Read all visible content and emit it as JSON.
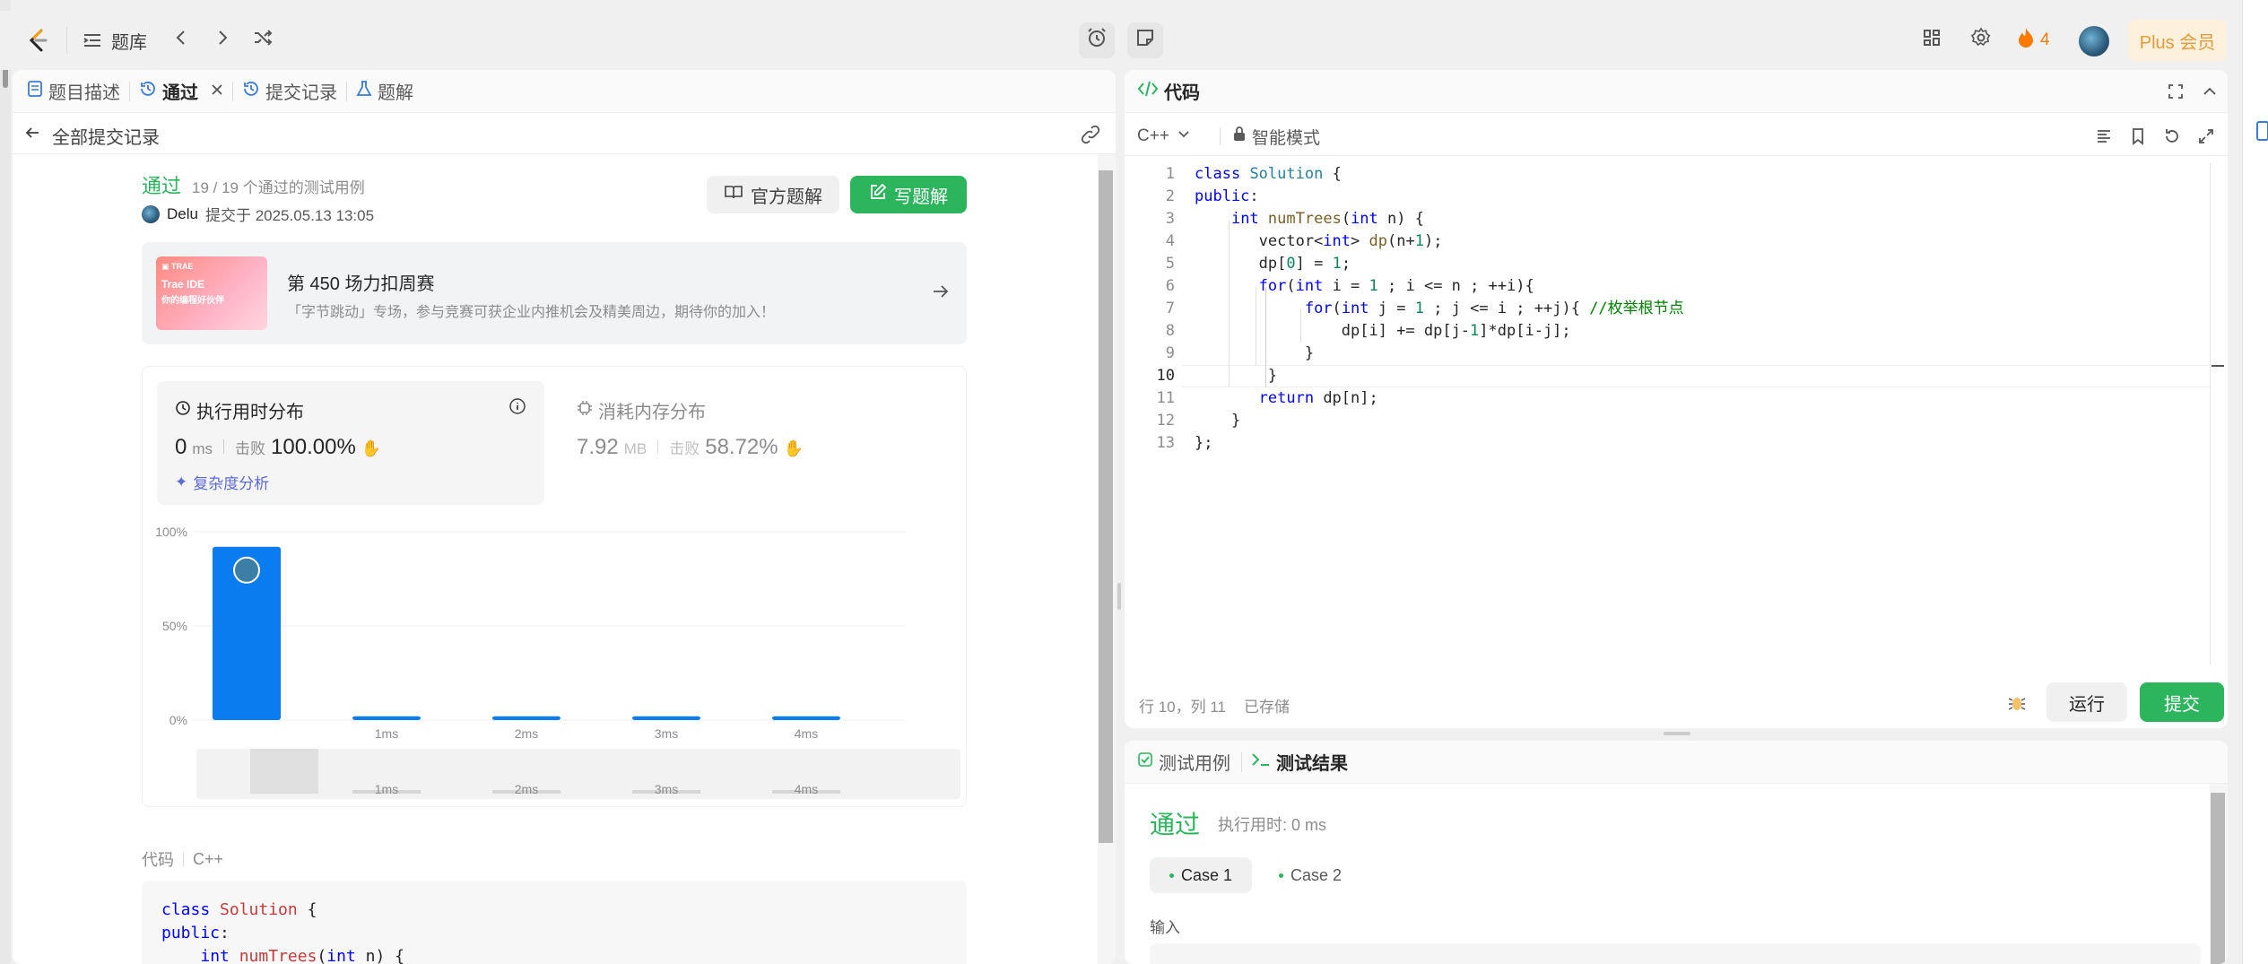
{
  "topbar": {
    "problem_bank": "题库",
    "streak": "4",
    "plus_label": "Plus 会员"
  },
  "left_tabs": [
    {
      "label": "题目描述",
      "icon": "description-icon"
    },
    {
      "label": "通过",
      "icon": "history-icon"
    },
    {
      "label": "提交记录",
      "icon": "history-icon"
    },
    {
      "label": "题解",
      "icon": "flask-icon"
    }
  ],
  "breadcrumb": {
    "back_label": "全部提交记录"
  },
  "submission": {
    "status": "通过",
    "testcases": "19 / 19 个通过的测试用例",
    "user": "Delu",
    "submitted_at": "提交于 2025.05.13 13:05",
    "official_solution": "官方题解",
    "write_solution": "写题解"
  },
  "banner": {
    "image_text_1": "Trae IDE",
    "image_text_2": "你的编程好伙伴",
    "title": "第 450 场力扣周赛",
    "subtitle": "「字节跳动」专场，参与竞赛可获企业内推机会及精美周边，期待你的加入！"
  },
  "runtime": {
    "title": "执行用时分布",
    "value": "0",
    "unit": "ms",
    "beats_label": "击败",
    "beats_value": "100.00%",
    "complexity": "复杂度分析"
  },
  "memory": {
    "title": "消耗内存分布",
    "value": "7.92",
    "unit": "MB",
    "beats_label": "击败",
    "beats_value": "58.72%"
  },
  "chart_data": {
    "type": "bar",
    "categories": [
      "0ms",
      "1ms",
      "2ms",
      "3ms",
      "4ms"
    ],
    "category_labels": [
      "",
      "1ms",
      "2ms",
      "3ms",
      "4ms"
    ],
    "values": [
      92,
      2,
      2,
      2,
      2
    ],
    "ylim": [
      0,
      100
    ],
    "yticks": [
      "100%",
      "50%",
      "0%"
    ],
    "xlabel": "",
    "ylabel": "",
    "bar_color": "#0a7cf0",
    "grid": true
  },
  "code_section": {
    "label": "代码",
    "lang": "C++",
    "preview": [
      "class Solution {",
      "public:",
      "    int numTrees(int n) {"
    ]
  },
  "editor": {
    "title": "代码",
    "lang": "C++",
    "mode": "智能模式",
    "line_numbers": [
      "1",
      "2",
      "3",
      "4",
      "5",
      "6",
      "7",
      "8",
      "9",
      "10",
      "11",
      "12",
      "13"
    ],
    "status_position": "行 10，列 11",
    "status_saved": "已存储",
    "run": "运行",
    "submit": "提交"
  },
  "results": {
    "tab_cases": "测试用例",
    "tab_results": "测试结果",
    "status": "通过",
    "runtime": "执行用时: 0 ms",
    "cases": [
      "Case 1",
      "Case 2"
    ],
    "input_label": "输入"
  },
  "colors": {
    "accent_green": "#2db55d",
    "bar_blue": "#0a7cf0",
    "plus_bg": "#fdf0dc",
    "plus_text": "#e49b3a",
    "streak": "#ff7a00"
  }
}
